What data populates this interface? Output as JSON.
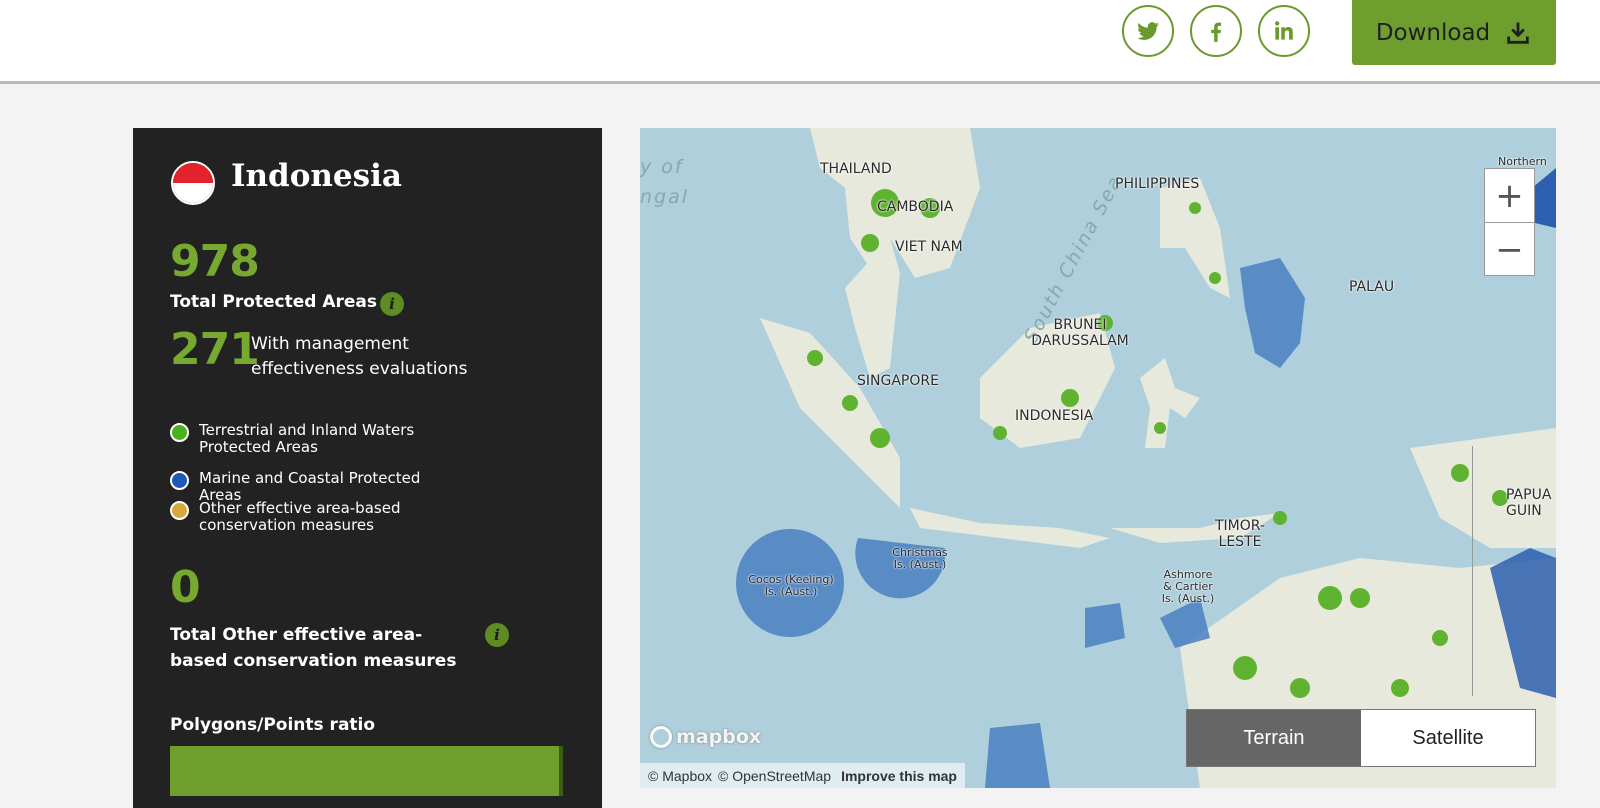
{
  "header": {
    "social": [
      "twitter-icon",
      "facebook-icon",
      "linkedin-icon"
    ],
    "download_label": "Download"
  },
  "sidebar": {
    "country": "Indonesia",
    "total_protected_areas": "978",
    "total_protected_areas_label": "Total Protected Areas",
    "mee_count": "271",
    "mee_label": "With management effectiveness evaluations",
    "legend": [
      {
        "label": "Terrestrial and Inland Waters Protected Areas",
        "color": "#49b020"
      },
      {
        "label": "Marine and Coastal Protected Areas",
        "color": "#1f58b5"
      },
      {
        "label": "Other effective area-based conservation measures",
        "color": "#d7a93a"
      }
    ],
    "total_oecm": "0",
    "total_oecm_label": "Total Other effective area-based conservation measures",
    "ratio_label": "Polygons/Points ratio",
    "info_glyph": "i"
  },
  "map": {
    "labels": {
      "thailand": "THAILAND",
      "cambodia": "CAMBODIA",
      "vietnam": "VIET NAM",
      "philippines": "PHILIPPINES",
      "palau": "PALAU",
      "brunei": "BRUNEI DARUSSALAM",
      "singapore": "SINGAPORE",
      "indonesia": "INDONESIA",
      "timor": "TIMOR- LESTE",
      "papua": "PAPUA GUIN",
      "cocos": "Cocos (Keeling) Is. (Aust.)",
      "christmas": "Christmas Is. (Aust.)",
      "ashmore": "Ashmore & Cartier Is. (Aust.)",
      "northern": "Northern M (US",
      "sea": "South China Sea",
      "bay_of": "y of",
      "bengal": "ngal"
    },
    "zoom_in": "+",
    "zoom_out": "−",
    "toggle": {
      "terrain": "Terrain",
      "satellite": "Satellite"
    },
    "logo": "mapbox",
    "attribution": {
      "mapbox": "© Mapbox",
      "osm": "© OpenStreetMap",
      "improve": "Improve this map"
    }
  }
}
